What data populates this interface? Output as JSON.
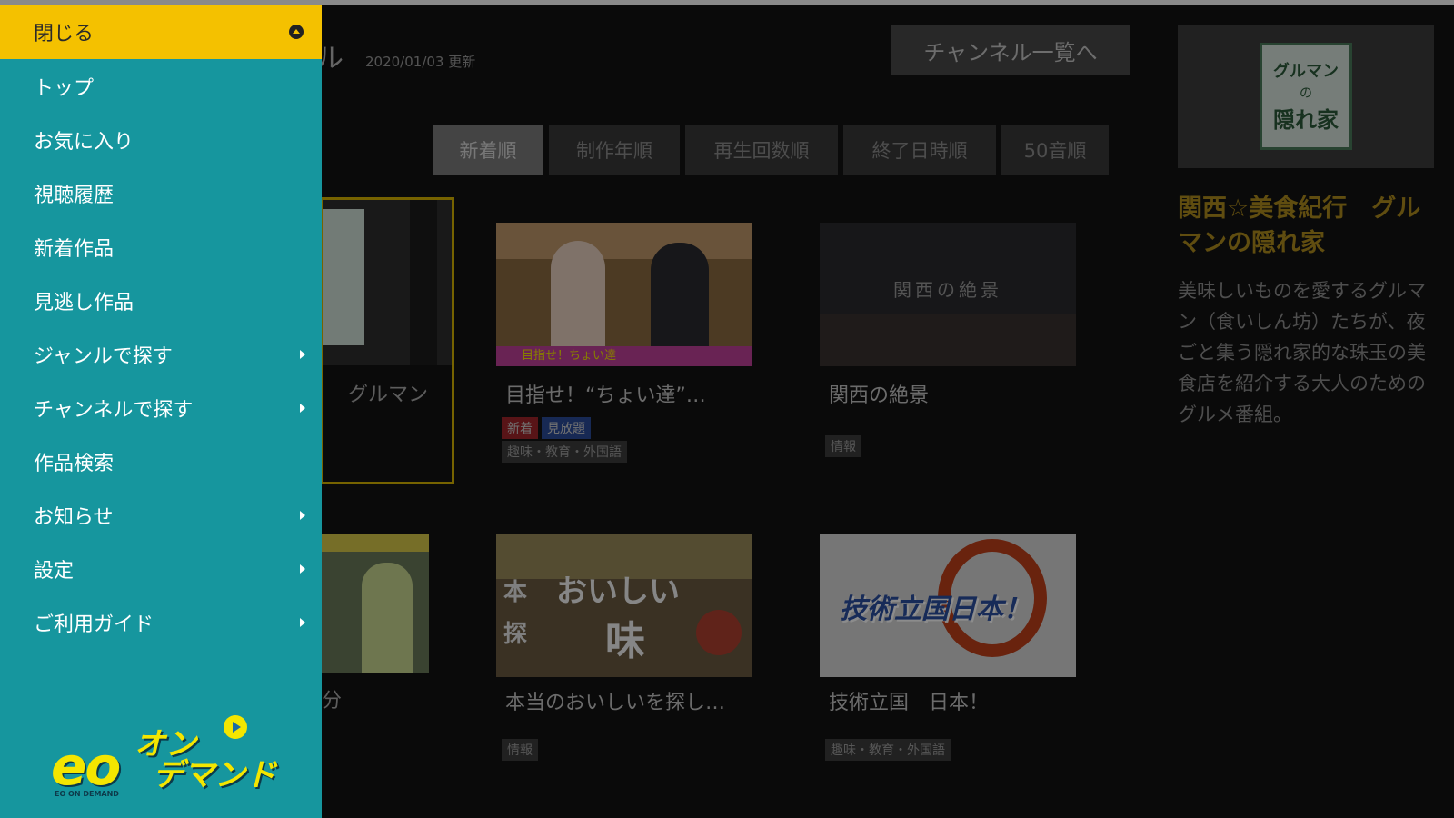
{
  "page": {
    "title_partial": "ル",
    "updated": "2020/01/03 更新",
    "channel_list_button": "チャンネル一覧へ"
  },
  "sort_tabs": [
    {
      "label": "新着順",
      "active": true
    },
    {
      "label": "制作年順",
      "active": false
    },
    {
      "label": "再生回数順",
      "active": false
    },
    {
      "label": "終了日時順",
      "active": false
    },
    {
      "label": "50音順",
      "active": false
    }
  ],
  "cards": {
    "selected_partial_title": "グルマン",
    "card1": {
      "title": "目指せ！“ちょい達”…",
      "badges": [
        "新着",
        "見放題"
      ],
      "genre": "趣味・教育・外国語",
      "thumb_banner": "目指せ！ちょい達"
    },
    "card2": {
      "title": "関西の絶景",
      "genre": "情報",
      "thumb_text": "関西の絶景"
    },
    "card3_partial": {
      "title_partial": "分"
    },
    "card4": {
      "title": "本当のおいしいを探し…",
      "genre": "情報",
      "thumb_text_1": "本",
      "thumb_text_2": "おいしい",
      "thumb_text_3": "味",
      "thumb_text_4": "探"
    },
    "card5": {
      "title": "技術立国　日本！",
      "genre": "趣味・教育・外国語",
      "thumb_text": "技術立国日本！"
    }
  },
  "detail": {
    "title": "関西☆美食紀行　グルマンの隠れ家",
    "description": "美味しいものを愛するグルマン（食いしん坊）たちが、夜ごと集う隠れ家的な珠玉の美食店を紹介する大人のためのグルメ番組。",
    "thumb_line1": "グルマン",
    "thumb_line2": "の",
    "thumb_line3": "隠れ家"
  },
  "menu": {
    "close_label": "閉じる",
    "items": [
      {
        "label": "トップ",
        "has_submenu": false
      },
      {
        "label": "お気に入り",
        "has_submenu": false
      },
      {
        "label": "視聴履歴",
        "has_submenu": false
      },
      {
        "label": "新着作品",
        "has_submenu": false
      },
      {
        "label": "見逃し作品",
        "has_submenu": false
      },
      {
        "label": "ジャンルで探す",
        "has_submenu": true
      },
      {
        "label": "チャンネルで探す",
        "has_submenu": true
      },
      {
        "label": "作品検索",
        "has_submenu": false
      },
      {
        "label": "お知らせ",
        "has_submenu": true
      },
      {
        "label": "設定",
        "has_submenu": true
      },
      {
        "label": "ご利用ガイド",
        "has_submenu": true
      }
    ],
    "logo": {
      "eo": "eo",
      "on": "オン",
      "demand": "デマンド",
      "sub": "EO ON DEMAND"
    }
  },
  "colors": {
    "menu_bg": "#16969e",
    "close_bar": "#f4c100",
    "selection_border": "#d7b500",
    "detail_title": "#b08d1e",
    "badge_new": "#a0262a",
    "badge_free": "#2a4b9a"
  },
  "icons": {
    "close": "close-icon",
    "submenu": "chevron-right-icon",
    "logo_play": "play-icon"
  }
}
